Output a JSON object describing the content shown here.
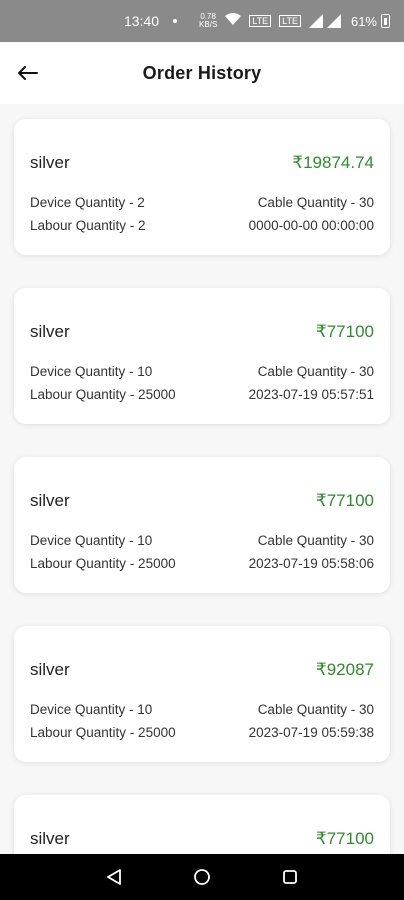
{
  "status_bar": {
    "time": "13:40",
    "data_speed_top": "0.78",
    "data_speed_bottom": "KB/S",
    "battery": "61%"
  },
  "header": {
    "title": "Order History"
  },
  "orders": [
    {
      "name": "silver",
      "price": "₹19874.74",
      "device_quantity": "Device Quantity - 2",
      "cable_quantity": "Cable Quantity - 30",
      "labour_quantity": "Labour Quantity - 2",
      "date": "0000-00-00 00:00:00"
    },
    {
      "name": "silver",
      "price": "₹77100",
      "device_quantity": "Device Quantity - 10",
      "cable_quantity": "Cable Quantity - 30",
      "labour_quantity": "Labour Quantity - 25000",
      "date": "2023-07-19 05:57:51"
    },
    {
      "name": "silver",
      "price": "₹77100",
      "device_quantity": "Device Quantity - 10",
      "cable_quantity": "Cable Quantity - 30",
      "labour_quantity": "Labour Quantity - 25000",
      "date": "2023-07-19 05:58:06"
    },
    {
      "name": "silver",
      "price": "₹92087",
      "device_quantity": "Device Quantity - 10",
      "cable_quantity": "Cable Quantity - 30",
      "labour_quantity": "Labour Quantity - 25000",
      "date": "2023-07-19 05:59:38"
    },
    {
      "name": "silver",
      "price": "₹77100"
    }
  ],
  "colors": {
    "price_green": "#2e8b2e",
    "status_bar": "#8a8a8a",
    "nav_bar": "#000000"
  },
  "icons": {
    "back": "arrow-left-icon",
    "nav_back": "triangle-back-icon",
    "nav_home": "circle-home-icon",
    "nav_recents": "square-recents-icon"
  }
}
